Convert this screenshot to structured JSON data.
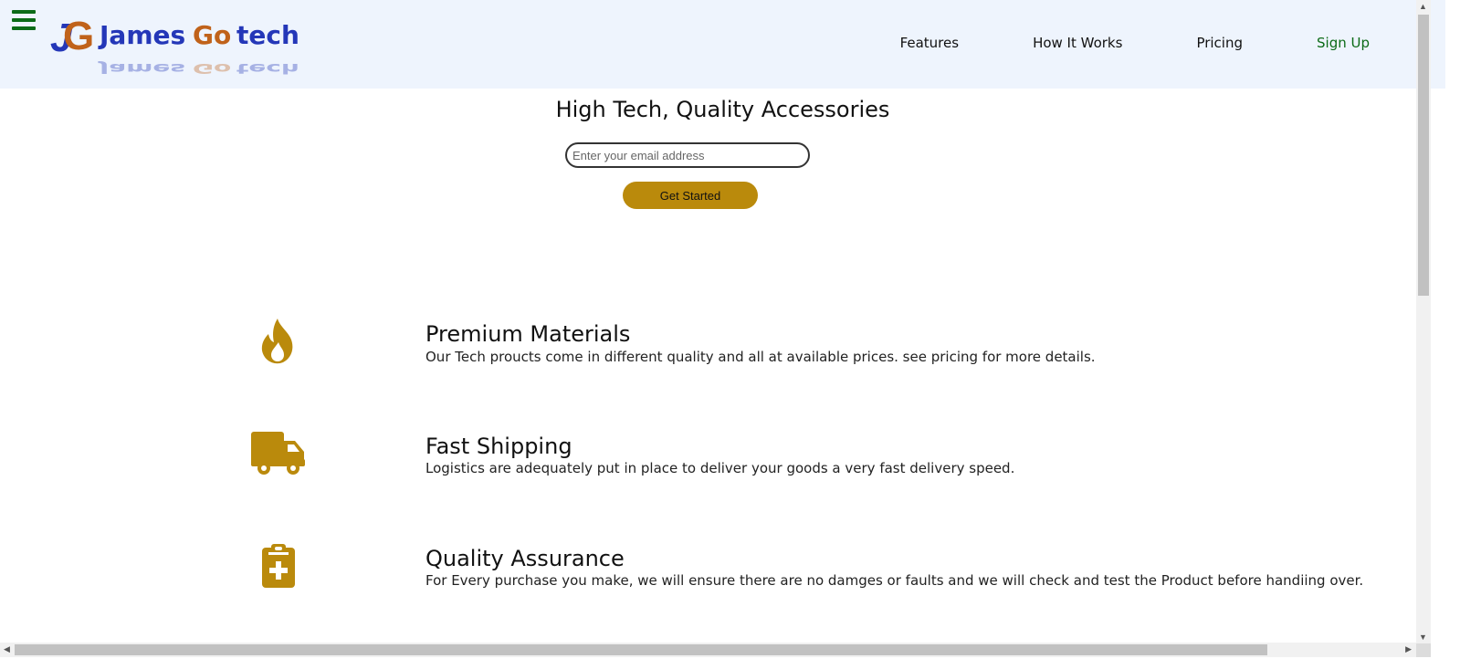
{
  "header": {
    "menu_icon": "hamburger-icon",
    "logo": {
      "text_primary": "James",
      "text_secondary": "Gotech",
      "initials": "JG"
    },
    "nav": [
      {
        "label": "Features"
      },
      {
        "label": "How It Works"
      },
      {
        "label": "Pricing"
      },
      {
        "label": "Sign Up"
      }
    ]
  },
  "hero": {
    "title": "High Tech, Quality Accessories",
    "email_placeholder": "Enter your email address",
    "cta_label": "Get Started"
  },
  "features": [
    {
      "icon": "fire-icon",
      "title": "Premium Materials",
      "text": "Our Tech proucts come in different quality and all at available prices. see pricing for more details."
    },
    {
      "icon": "truck-icon",
      "title": "Fast Shipping",
      "text": "Logistics are adequately put in place to deliver your goods a very fast delivery speed."
    },
    {
      "icon": "clipboard-medical-icon",
      "title": "Quality Assurance",
      "text": "For Every purchase you make, we will ensure there are no damges or faults and we will check and test the Product before handiing over."
    }
  ],
  "colors": {
    "accent": "#ba8a0c",
    "header_bg": "#eef4fd",
    "menu_green": "#0c6b17",
    "logo_blue": "#2437b8",
    "logo_orange": "#c0621a"
  }
}
